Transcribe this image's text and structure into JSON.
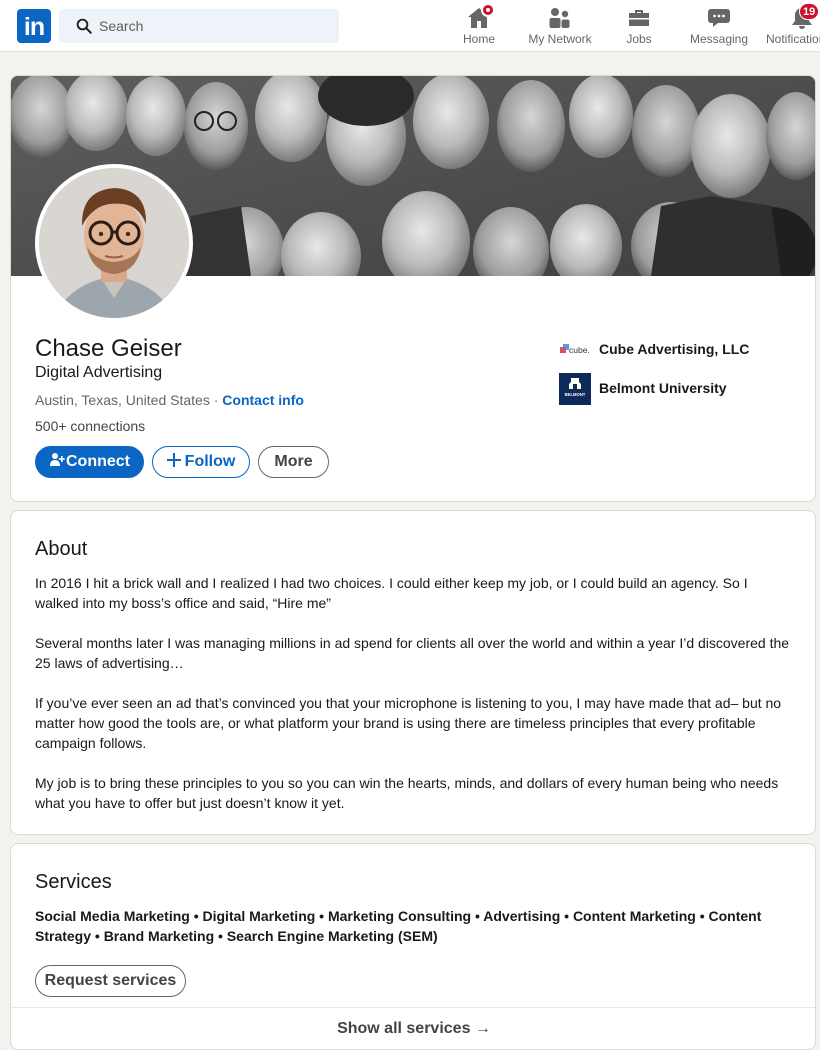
{
  "nav": {
    "logo_text": "in",
    "search_placeholder": "Search",
    "items": [
      {
        "label": "Home",
        "icon": "home-icon"
      },
      {
        "label": "My Network",
        "icon": "network-icon"
      },
      {
        "label": "Jobs",
        "icon": "briefcase-icon"
      },
      {
        "label": "Messaging",
        "icon": "messaging-icon"
      },
      {
        "label": "Notifications",
        "icon": "bell-icon"
      }
    ],
    "notification_count": "19"
  },
  "profile": {
    "name": "Chase Geiser",
    "headline": "Digital Advertising",
    "location": "Austin, Texas, United States",
    "separator": " · ",
    "contact_info": "Contact info",
    "connections": "500+ connections",
    "buttons": {
      "connect": "Connect",
      "follow": "Follow",
      "more": "More"
    },
    "orgs": [
      {
        "name": "Cube Advertising, LLC",
        "logo_text": "cube."
      },
      {
        "name": "Belmont University",
        "logo_text": "BELMONT"
      }
    ]
  },
  "about": {
    "title": "About",
    "paragraphs": [
      "In 2016 I hit a brick wall and I realized I had two choices. I could either keep my job, or I could build an agency. So I walked into my boss’s office and said, “Hire me”",
      "Several months later I was managing millions in ad spend for clients all over the world and within a year I’d discovered the 25 laws of advertising…",
      "If you’ve ever seen an ad that’s convinced you that your microphone is listening to you, I may have made that ad– but no matter how good the tools are, or what platform your brand is using there are timeless principles that every profitable campaign follows.",
      "My job is to bring these principles to you so you can win the hearts, minds, and dollars of every human being who needs what you have to offer but just doesn’t know it yet."
    ]
  },
  "services": {
    "title": "Services",
    "list": "Social Media Marketing • Digital Marketing • Marketing Consulting • Advertising • Content Marketing • Content Strategy • Brand Marketing • Search Engine Marketing (SEM)",
    "request_button": "Request services",
    "show_all": "Show all services →"
  },
  "colors": {
    "brand": "#0a66c2",
    "badge": "#cb112d",
    "page_bg": "#f4f2ee"
  }
}
